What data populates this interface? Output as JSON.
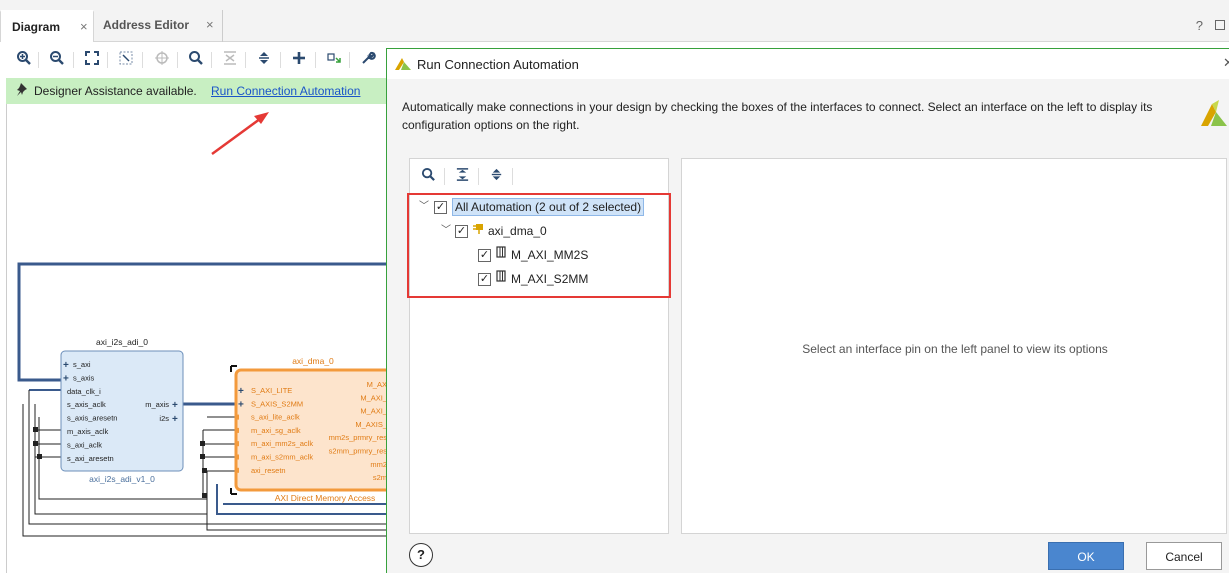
{
  "tabs": [
    {
      "label": "Diagram",
      "close": "×"
    },
    {
      "label": "Address Editor",
      "close": "×"
    }
  ],
  "window": {
    "help": "?"
  },
  "designer": {
    "text": "Designer Assistance available.",
    "link": "Run Connection Automation"
  },
  "diagram": {
    "i2s_block": {
      "instance": "axi_i2s_adi_0",
      "module": "axi_i2s_adi_v1_0",
      "left_ports": [
        "s_axi",
        "s_axis",
        "data_clk_i",
        "s_axis_aclk",
        "s_axis_aresetn",
        "m_axis_aclk",
        "s_axi_aclk",
        "s_axi_aresetn"
      ],
      "right_ports": [
        "m_axis",
        "i2s"
      ]
    },
    "dma_block": {
      "instance": "axi_dma_0",
      "module": "AXI Direct Memory Access",
      "left_ports": [
        "S_AXI_LITE",
        "S_AXIS_S2MM",
        "s_axi_lite_aclk",
        "m_axi_sg_aclk",
        "m_axi_mm2s_aclk",
        "m_axi_s2mm_aclk",
        "axi_resetn"
      ],
      "right_ports": [
        "M_AX",
        "M_AXI_",
        "M_AXI_",
        "M_AXIS_",
        "mm2s_prmry_res",
        "s2mm_prmry_res",
        "mm2",
        "s2m"
      ]
    }
  },
  "dialog": {
    "title": "Run Connection Automation",
    "description": "Automatically make connections in your design by checking the boxes of the interfaces to connect. Select an interface on the left to display its configuration options on the right.",
    "tree": {
      "root": "All Automation (2 out of 2 selected)",
      "ip": "axi_dma_0",
      "items": [
        "M_AXI_MM2S",
        "M_AXI_S2MM"
      ]
    },
    "right_message": "Select an interface pin on the left panel to view its options",
    "help": "?",
    "ok": "OK",
    "cancel": "Cancel"
  },
  "colors": {
    "designer_bar": "#c8efc2",
    "link": "#1a55c8",
    "dma_orange": "#f39a3c",
    "i2s_blue": "#dbe9f7",
    "bus_blue": "#3a5a8c",
    "red_highlight": "#e53935",
    "ok_blue": "#4a86cf"
  }
}
